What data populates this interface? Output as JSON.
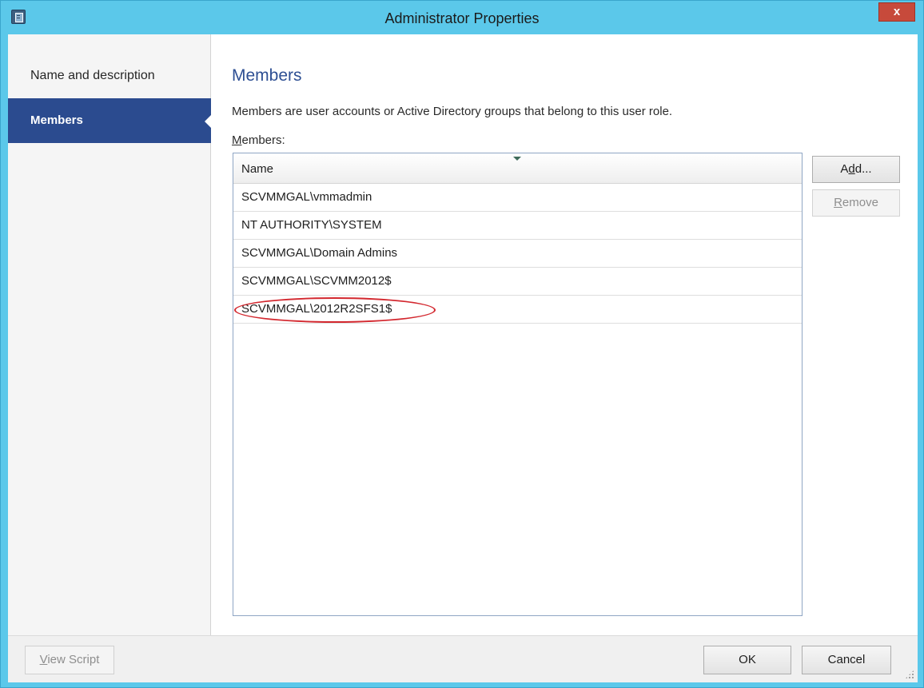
{
  "window": {
    "title": "Administrator Properties",
    "close_label": "x",
    "accent_color": "#5bc8ea"
  },
  "nav": {
    "items": [
      {
        "label": "Name and description",
        "selected": false
      },
      {
        "label": "Members",
        "selected": true
      }
    ],
    "selected_color": "#2b4b8f"
  },
  "main": {
    "heading": "Members",
    "description": "Members are user accounts or Active Directory groups that belong to this user role.",
    "members_label_first": "M",
    "members_label_rest": "embers:",
    "grid": {
      "column_header": "Name",
      "rows": [
        "SCVMMGAL\\vmmadmin",
        "NT AUTHORITY\\SYSTEM",
        "SCVMMGAL\\Domain Admins",
        "SCVMMGAL\\SCVMM2012$",
        "SCVMMGAL\\2012R2SFS1$"
      ],
      "highlighted_row": 4,
      "highlight_color": "#d3282f"
    },
    "buttons": {
      "add": {
        "pre": "A",
        "accel": "d",
        "post": "d..."
      },
      "remove": {
        "accel": "R",
        "post": "emove",
        "enabled": false
      }
    }
  },
  "footer": {
    "view_script": {
      "accel": "V",
      "post": "iew Script",
      "enabled": false
    },
    "ok_label": "OK",
    "cancel_label": "Cancel"
  }
}
